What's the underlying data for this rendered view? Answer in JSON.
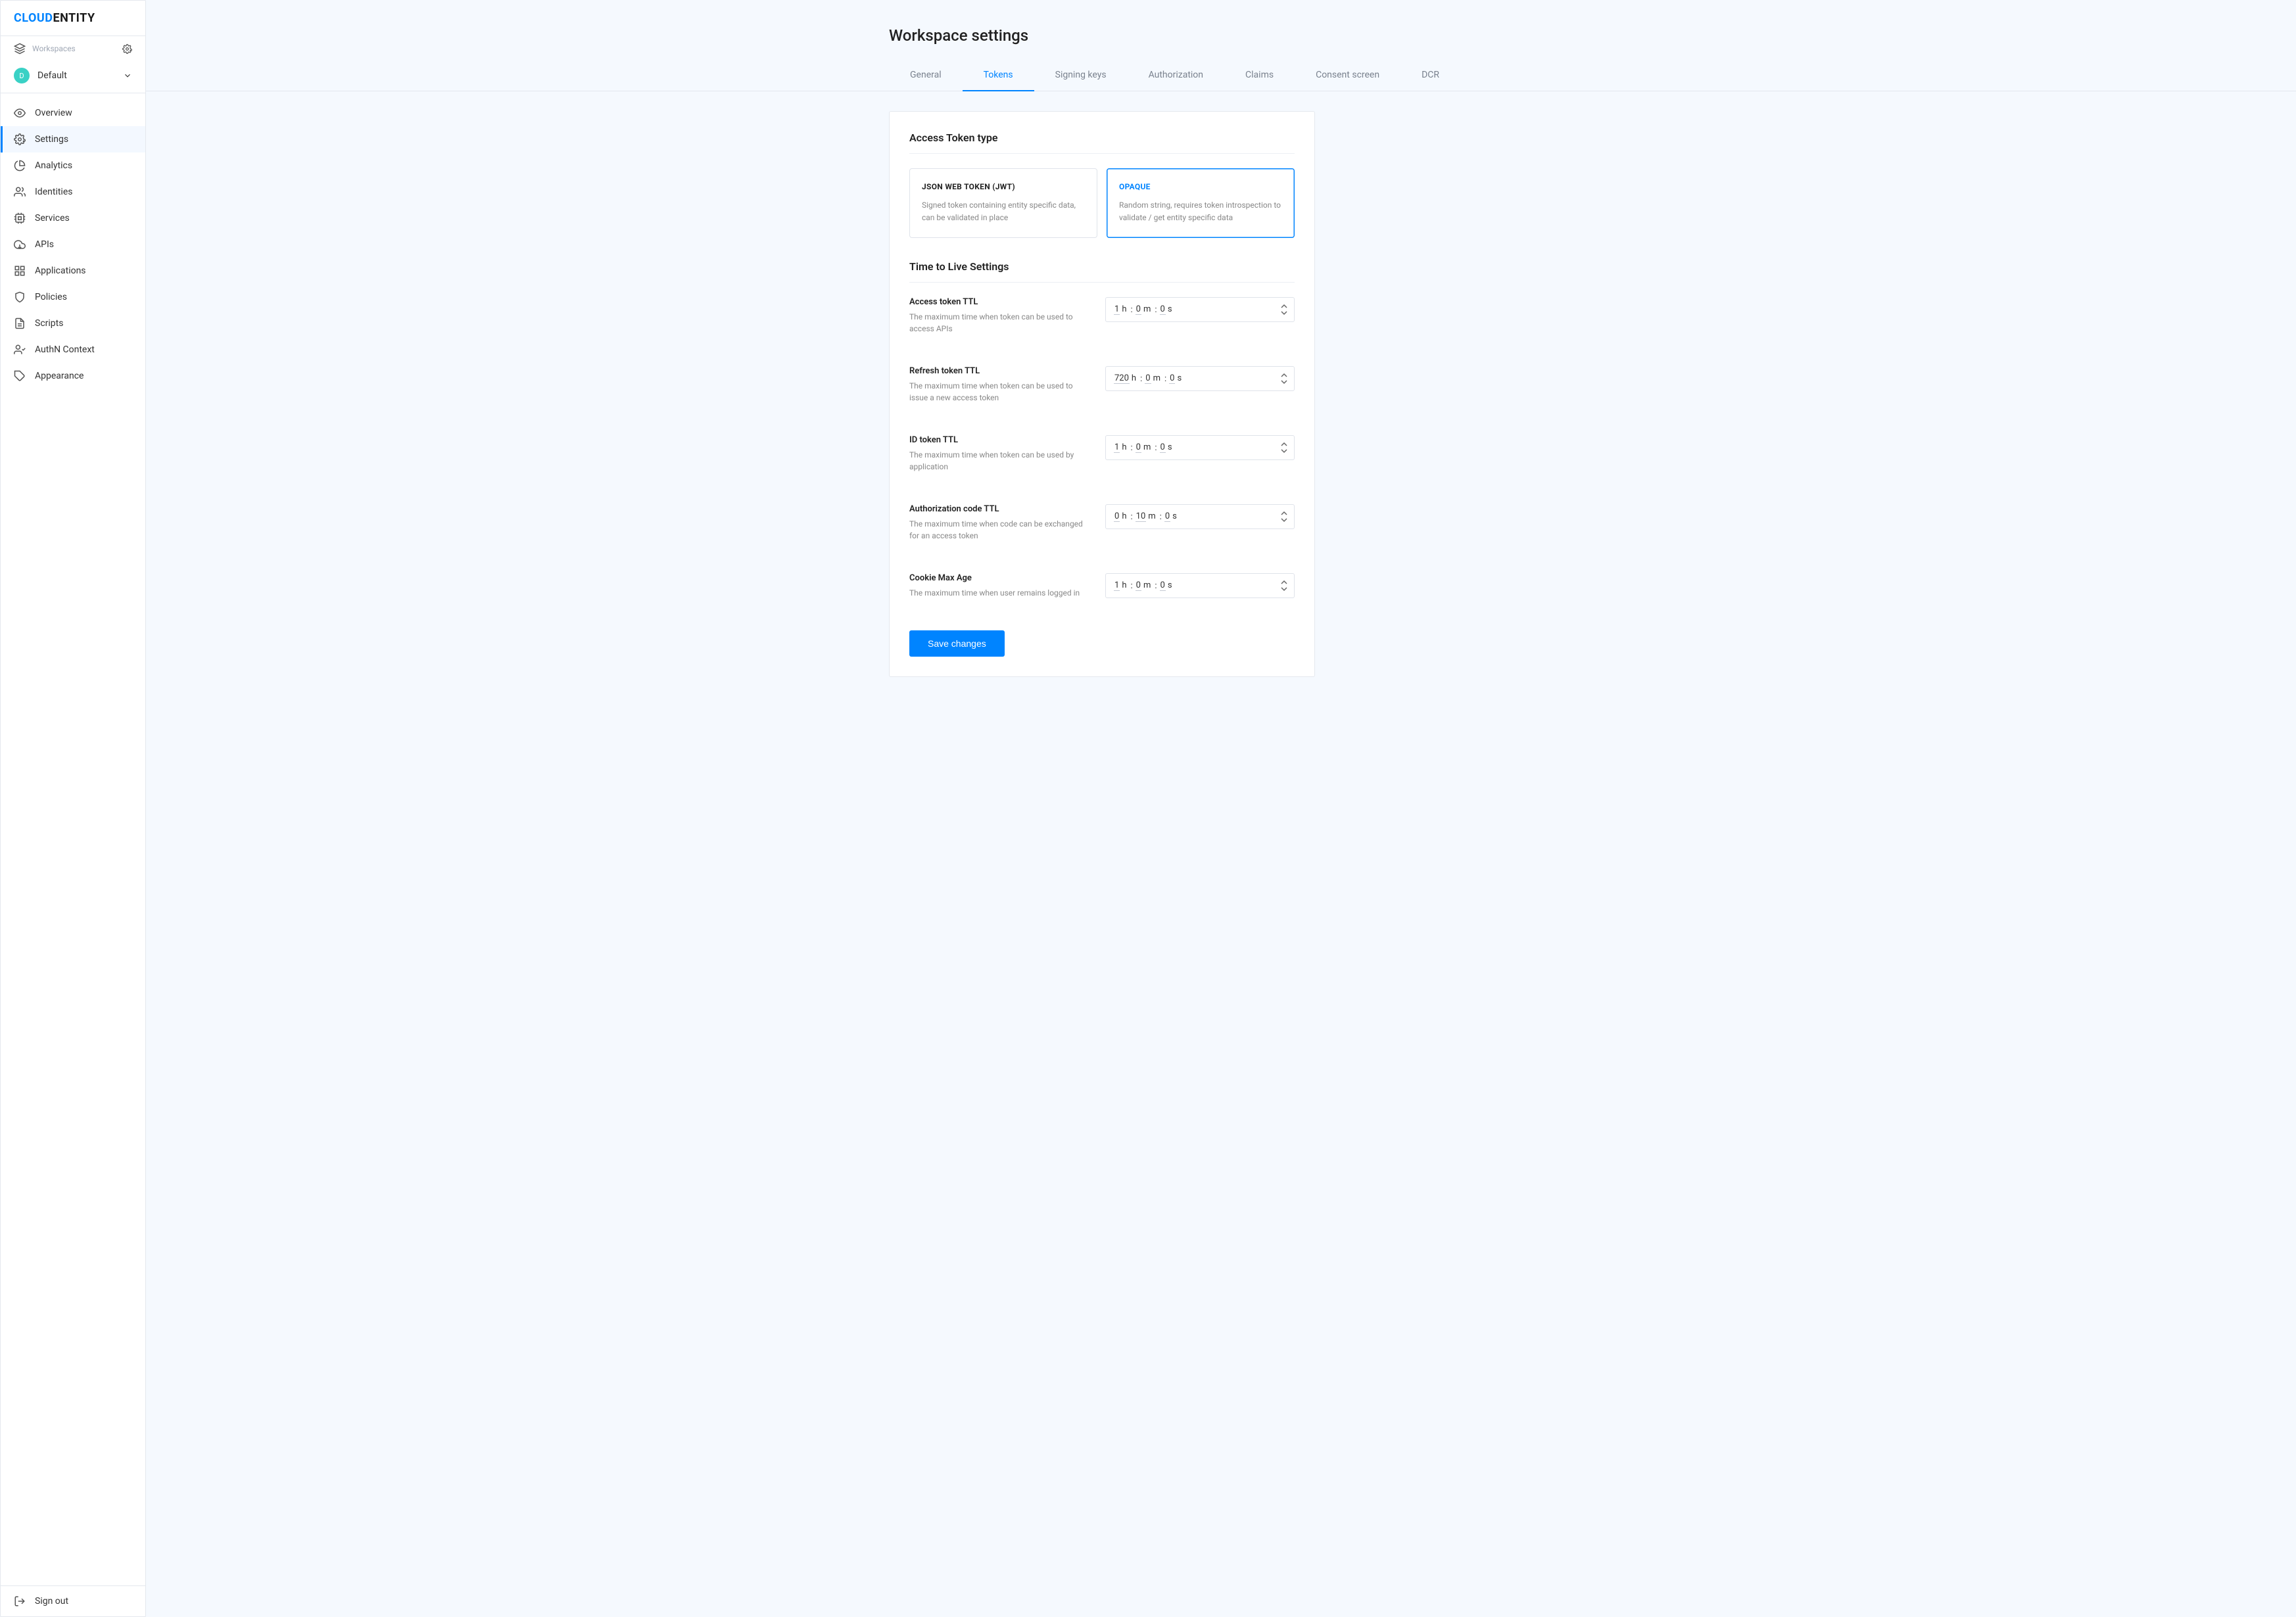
{
  "brand": {
    "bold": "CLOUD",
    "rest": "ENTITY"
  },
  "sidebar": {
    "workspacesLabel": "Workspaces",
    "current": {
      "initial": "D",
      "name": "Default"
    },
    "items": [
      {
        "key": "overview",
        "label": "Overview"
      },
      {
        "key": "settings",
        "label": "Settings"
      },
      {
        "key": "analytics",
        "label": "Analytics"
      },
      {
        "key": "identities",
        "label": "Identities"
      },
      {
        "key": "services",
        "label": "Services"
      },
      {
        "key": "apis",
        "label": "APIs"
      },
      {
        "key": "applications",
        "label": "Applications"
      },
      {
        "key": "policies",
        "label": "Policies"
      },
      {
        "key": "scripts",
        "label": "Scripts"
      },
      {
        "key": "authn",
        "label": "AuthN Context"
      },
      {
        "key": "appearance",
        "label": "Appearance"
      }
    ],
    "signOut": "Sign out"
  },
  "page": {
    "title": "Workspace settings"
  },
  "tabs": [
    "General",
    "Tokens",
    "Signing keys",
    "Authorization",
    "Claims",
    "Consent screen",
    "DCR"
  ],
  "activeTab": "Tokens",
  "tokens": {
    "typeSection": "Access Token type",
    "types": {
      "jwt": {
        "title": "JSON WEB TOKEN (JWT)",
        "desc": "Signed token containing entity specific data, can be validated in place"
      },
      "opaque": {
        "title": "OPAQUE",
        "desc": "Random string, requires token introspection to validate / get entity specific data"
      }
    },
    "ttlSection": "Time to Live Settings",
    "rows": {
      "access": {
        "title": "Access token TTL",
        "desc": "The maximum time when token can be used to access APIs",
        "h": "1",
        "m": "0",
        "s": "0"
      },
      "refresh": {
        "title": "Refresh token TTL",
        "desc": "The maximum time when token can be used to issue a new access token",
        "h": "720",
        "m": "0",
        "s": "0"
      },
      "id": {
        "title": "ID token TTL",
        "desc": "The maximum time when token can be used by application",
        "h": "1",
        "m": "0",
        "s": "0"
      },
      "authz": {
        "title": "Authorization code TTL",
        "desc": "The maximum time when code can be exchanged for an access token",
        "h": "0",
        "m": "10",
        "s": "0"
      },
      "cookie": {
        "title": "Cookie Max Age",
        "desc": "The maximum time when user remains logged in",
        "h": "1",
        "m": "0",
        "s": "0"
      }
    },
    "hLabel": "h",
    "mLabel": "m",
    "sLabel": "s",
    "colon": ":",
    "save": "Save changes"
  }
}
